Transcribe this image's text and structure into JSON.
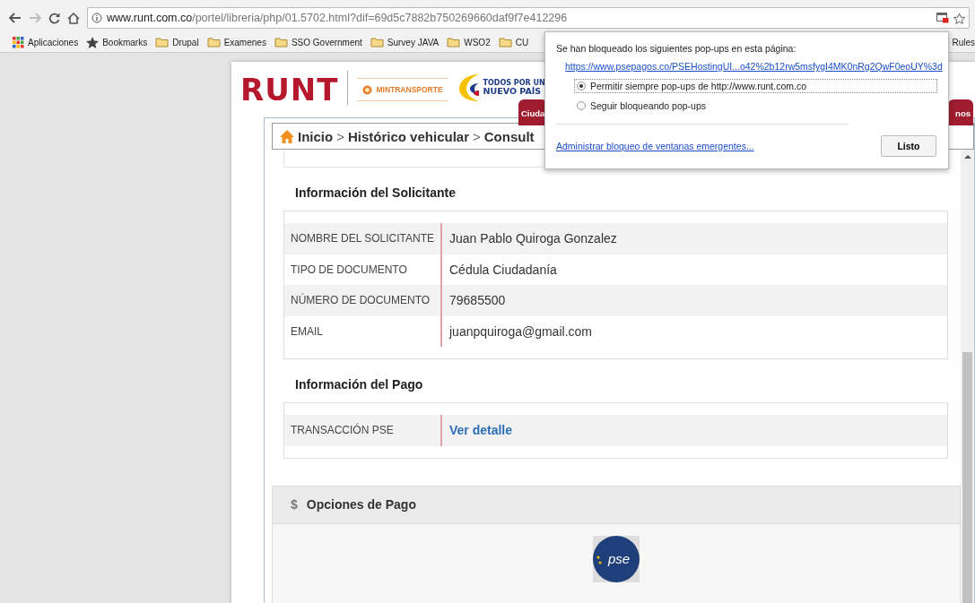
{
  "browser": {
    "url_host": "www.runt.com.co",
    "url_path": "/portel/libreria/php/01.5702.html?dif=69d5c7882b750269660daf9f7e412296",
    "bookmarks": [
      {
        "label": "Aplicaciones",
        "kind": "apps"
      },
      {
        "label": "Bookmarks",
        "kind": "star"
      },
      {
        "label": "Drupal",
        "kind": "folder"
      },
      {
        "label": "Examenes",
        "kind": "folder"
      },
      {
        "label": "SSO Government",
        "kind": "folder"
      },
      {
        "label": "Survey JAVA",
        "kind": "folder"
      },
      {
        "label": "WSO2",
        "kind": "folder"
      },
      {
        "label": "CU",
        "kind": "folder"
      }
    ],
    "bookmark_right": "Rules"
  },
  "popup": {
    "message": "Se han bloqueado los siguientes pop-ups en esta página:",
    "link": "https://www.psepagos.co/PSEHostingUI...o42%2b12rw5msfygI4MK0nRg2QwF0eoUY%3d",
    "options": [
      {
        "label": "Permitir siempre pop-ups de http://www.runt.com.co",
        "selected": true
      },
      {
        "label": "Seguir bloqueando pop-ups",
        "selected": false
      }
    ],
    "manage_link": "Administrar bloqueo de ventanas emergentes...",
    "button": "Listo"
  },
  "header": {
    "logo": "RUNT",
    "ministry": "MINTRANSPORTE",
    "slogan_top": "TODOS POR UN",
    "slogan_bottom": "NUEVO PAÍS",
    "tab_left": "Ciuda",
    "tab_right": "nos"
  },
  "breadcrumb": [
    {
      "label": "Inicio"
    },
    {
      "separator": ">",
      "label": "Histórico vehicular"
    },
    {
      "separator": ">",
      "label": "Consult"
    }
  ],
  "sections": [
    {
      "title": "Información del Solicitante",
      "rows": [
        {
          "label": "NOMBRE DEL SOLICITANTE",
          "value": "Juan Pablo Quiroga Gonzalez",
          "kind": "text"
        },
        {
          "label": "TIPO DE DOCUMENTO",
          "value": "Cédula Ciudadanía",
          "kind": "text"
        },
        {
          "label": "NÚMERO DE DOCUMENTO",
          "value": "79685500",
          "kind": "text"
        },
        {
          "label": "EMAIL",
          "value": "juanpquiroga@gmail.com",
          "kind": "text"
        }
      ]
    },
    {
      "title": "Información del Pago",
      "rows": [
        {
          "label": "TRANSACCIÓN PSE",
          "value": "Ver detalle",
          "kind": "link"
        }
      ]
    }
  ],
  "payment": {
    "symbol": "$",
    "title": "Opciones de Pago",
    "logo": "pse"
  }
}
